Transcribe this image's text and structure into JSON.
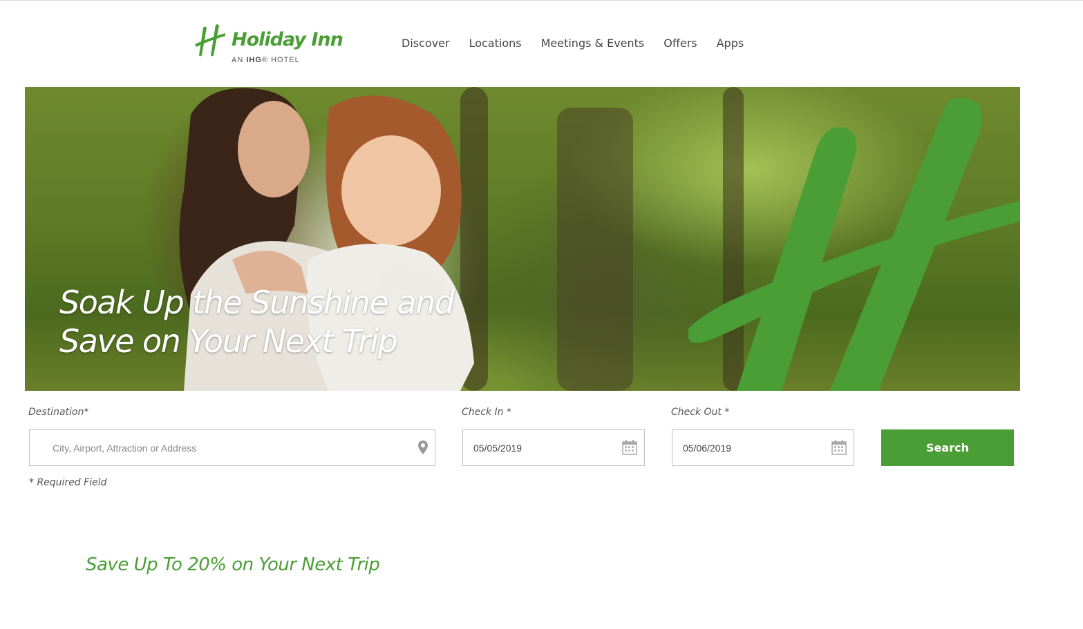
{
  "header": {
    "brand": "Holiday Inn",
    "sub_prefix": "AN ",
    "sub_bold": "IHG",
    "sub_suffix": "® HOTEL",
    "nav": [
      "Discover",
      "Locations",
      "Meetings & Events",
      "Offers",
      "Apps"
    ]
  },
  "hero": {
    "headline_line1": "Soak Up the Sunshine and",
    "headline_line2": "Save on Your Next Trip"
  },
  "search": {
    "destination_label": "Destination*",
    "destination_placeholder": "City, Airport, Attraction or Address",
    "checkin_label": "Check In *",
    "checkin_value": "05/05/2019",
    "checkout_label": "Check Out *",
    "checkout_value": "05/06/2019",
    "button_label": "Search",
    "required_note": "* Required Field"
  },
  "promo": {
    "title": "Save Up To 20% on Your Next Trip"
  },
  "colors": {
    "brand_green": "#4a9e35",
    "nav_text": "#444444",
    "border": "#bfbfbf"
  },
  "icons": [
    "holiday-inn-h-logo-icon",
    "map-pin-icon",
    "calendar-icon"
  ]
}
